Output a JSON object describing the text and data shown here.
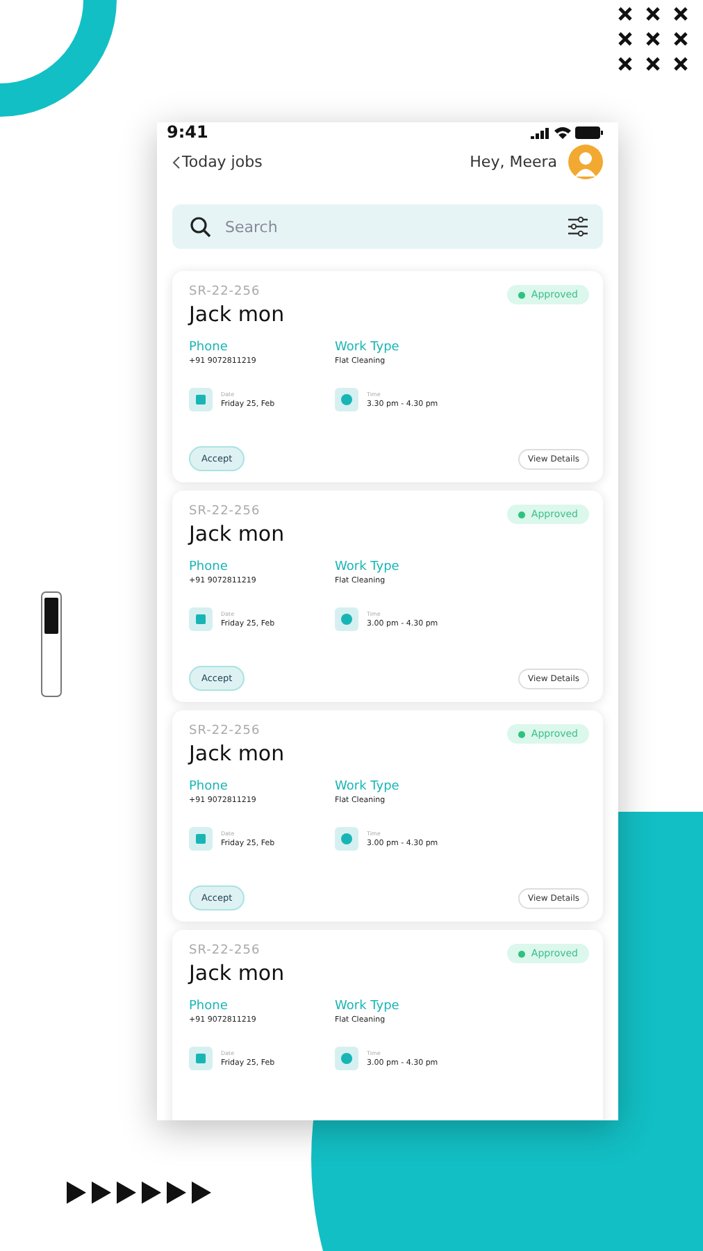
{
  "status_bar": {
    "time": "9:41"
  },
  "header": {
    "back_label": "Today jobs",
    "greeting": "Hey, Meera"
  },
  "search": {
    "placeholder": "Search"
  },
  "jobs": [
    {
      "code": "SR-22-256",
      "name": "Jack mon",
      "status": "Approved",
      "phone_label": "Phone",
      "phone": "+91 9072811219",
      "work_type_label": "Work Type",
      "work_type": "Flat Cleaning",
      "date_label": "Date",
      "date": "Friday 25, Feb",
      "time_label": "Time",
      "time": "3.30 pm - 4.30 pm",
      "accept": "Accept",
      "details": "View Details"
    },
    {
      "code": "SR-22-256",
      "name": "Jack mon",
      "status": "Approved",
      "phone_label": "Phone",
      "phone": "+91 9072811219",
      "work_type_label": "Work Type",
      "work_type": "Flat Cleaning",
      "date_label": "Date",
      "date": "Friday 25, Feb",
      "time_label": "Time",
      "time": "3.00 pm - 4.30 pm",
      "accept": "Accept",
      "details": "View Details"
    },
    {
      "code": "SR-22-256",
      "name": "Jack mon",
      "status": "Approved",
      "phone_label": "Phone",
      "phone": "+91 9072811219",
      "work_type_label": "Work Type",
      "work_type": "Flat Cleaning",
      "date_label": "Date",
      "date": "Friday 25, Feb",
      "time_label": "Time",
      "time": "3.00 pm - 4.30 pm",
      "accept": "Accept",
      "details": "View Details"
    },
    {
      "code": "SR-22-256",
      "name": "Jack mon",
      "status": "Approved",
      "phone_label": "Phone",
      "phone": "+91 9072811219",
      "work_type_label": "Work Type",
      "work_type": "Flat Cleaning",
      "date_label": "Date",
      "date": "Friday 25, Feb",
      "time_label": "Time",
      "time": "3.00 pm - 4.30 pm"
    }
  ]
}
